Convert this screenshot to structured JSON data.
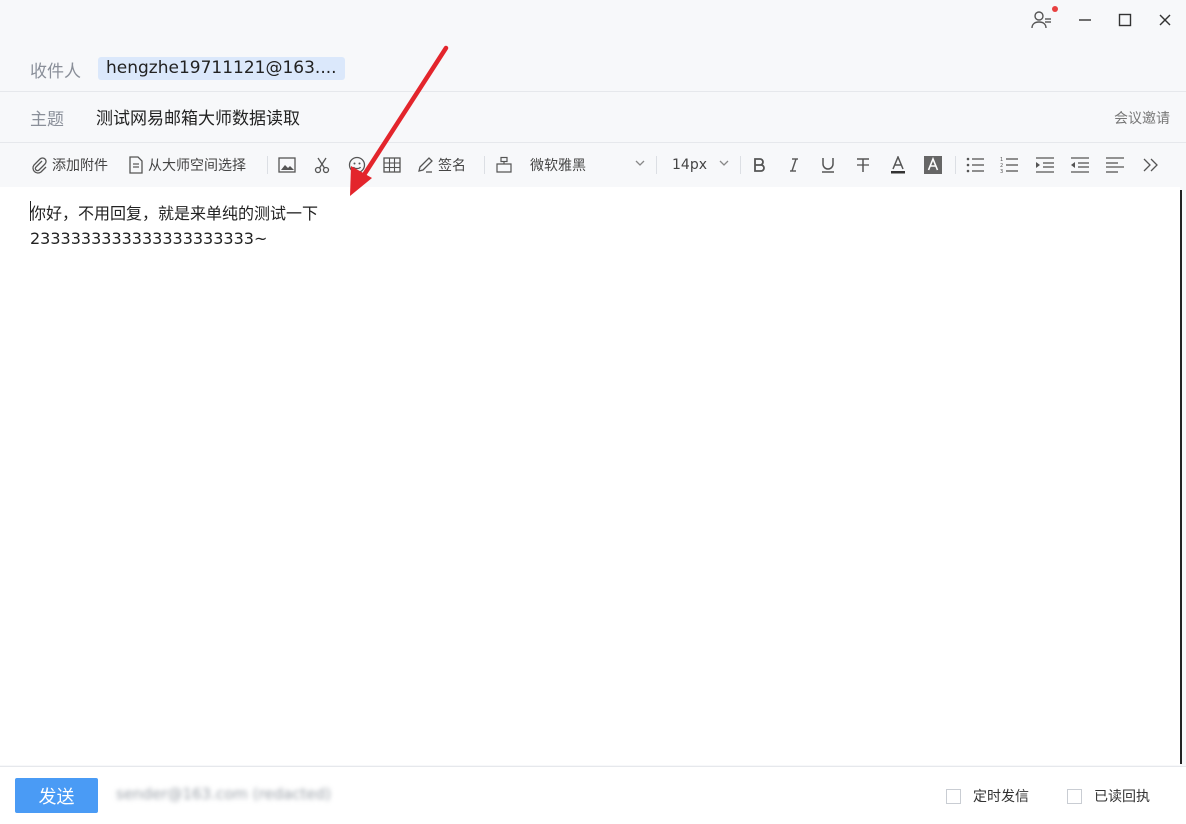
{
  "header": {
    "to_label": "收件人",
    "recipient": "hengzhe19711121@163....",
    "subject_label": "主题",
    "subject": "测试网易邮箱大师数据读取",
    "meeting_invite": "会议邀请"
  },
  "toolbar": {
    "add_attachment": "添加附件",
    "from_space": "从大师空间选择",
    "signature": "签名",
    "font_family": "微软雅黑",
    "font_size": "14px"
  },
  "editor": {
    "line1": "你好，不用回复，就是来单纯的测试一下",
    "line2": "2333333333333333333333~"
  },
  "footer": {
    "send_label": "发送",
    "sender_account": "sender@163.com (redacted)",
    "scheduled_send": "定时发信",
    "read_receipt": "已读回执"
  },
  "colors": {
    "accent": "#4a9bf5",
    "recipient_chip": "#dbe8fb",
    "annotation_arrow": "#e3252c",
    "notification_dot": "#e84040"
  },
  "icons": [
    "contacts-icon",
    "minimize-icon",
    "maximize-icon",
    "close-icon",
    "paperclip-icon",
    "file-icon",
    "image-icon",
    "scissors-icon",
    "emoji-icon",
    "table-icon",
    "pen-icon",
    "format-painter-icon",
    "chevron-down-icon",
    "bold-icon",
    "italic-icon",
    "underline-icon",
    "strikethrough-icon",
    "font-color-icon",
    "highlight-icon",
    "bullet-list-icon",
    "numbered-list-icon",
    "indent-icon",
    "outdent-icon",
    "align-icon",
    "more-icon"
  ]
}
